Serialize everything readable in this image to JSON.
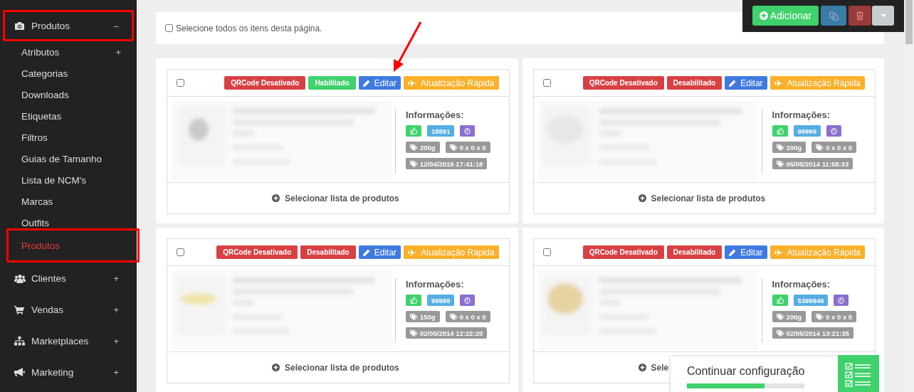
{
  "sidebar": {
    "groups": [
      {
        "label": "Produtos",
        "toggle": "–",
        "highlighted": true,
        "items": [
          {
            "label": "Atributos",
            "toggle": "+",
            "selected": false,
            "highlighted": false
          },
          {
            "label": "Categorias",
            "selected": false,
            "highlighted": false
          },
          {
            "label": "Downloads",
            "selected": false,
            "highlighted": false
          },
          {
            "label": "Etiquetas",
            "selected": false,
            "highlighted": false
          },
          {
            "label": "Filtros",
            "selected": false,
            "highlighted": false
          },
          {
            "label": "Guias de Tamanho",
            "selected": false,
            "highlighted": false
          },
          {
            "label": "Lista de NCM's",
            "selected": false,
            "highlighted": false
          },
          {
            "label": "Marcas",
            "selected": false,
            "highlighted": false
          },
          {
            "label": "Outfits",
            "selected": false,
            "highlighted": false
          },
          {
            "label": "Produtos",
            "selected": true,
            "highlighted": true
          }
        ]
      },
      {
        "label": "Clientes",
        "toggle": "+",
        "highlighted": false
      },
      {
        "label": "Vendas",
        "toggle": "+",
        "highlighted": false
      },
      {
        "label": "Marketplaces",
        "toggle": "+",
        "highlighted": false
      },
      {
        "label": "Marketing",
        "toggle": "+",
        "highlighted": false
      }
    ]
  },
  "toolbar": {
    "add_label": "Adicionar"
  },
  "select_all": {
    "label": "Selecione todos os itens desta página.",
    "checked": false
  },
  "cards": [
    {
      "checked": false,
      "qrcode": {
        "label": "QRCode Desativado",
        "enabled": false
      },
      "status": {
        "label": "Habilitado",
        "enabled": true
      },
      "edit": "Editar",
      "quick_update": "Atualização Rápida",
      "info_title": "Informações:",
      "code": "18991",
      "weight": "200g",
      "dimensions": "0 x 0 x 0",
      "date": "12/04/2019 17:41:18",
      "footer": "Selecionar lista de produtos"
    },
    {
      "checked": false,
      "qrcode": {
        "label": "QRCode Desativado",
        "enabled": false
      },
      "status": {
        "label": "Desabilitado",
        "enabled": false
      },
      "edit": "Editar",
      "quick_update": "Atualização Rápida",
      "info_title": "Informações:",
      "code": "99999",
      "weight": "200g",
      "dimensions": "0 x 0 x 0",
      "date": "05/05/2014 11:58:33",
      "footer": "Selecionar lista de produtos"
    },
    {
      "checked": false,
      "qrcode": {
        "label": "QRCode Desativado",
        "enabled": false
      },
      "status": {
        "label": "Desabilitado",
        "enabled": false
      },
      "edit": "Editar",
      "quick_update": "Atualização Rápida",
      "info_title": "Informações:",
      "code": "99999",
      "weight": "150g",
      "dimensions": "0 x 0 x 0",
      "date": "02/05/2014 12:22:20",
      "footer": "Selecionar lista de produtos"
    },
    {
      "checked": false,
      "qrcode": {
        "label": "QRCode Desativado",
        "enabled": false
      },
      "status": {
        "label": "Desabilitado",
        "enabled": false
      },
      "edit": "Editar",
      "quick_update": "Atualização Rápida",
      "info_title": "Informações:",
      "code": "5399946",
      "weight": "200g",
      "dimensions": "0 x 0 x 0",
      "date": "02/05/2014 13:21:35",
      "footer": "Sele"
    }
  ],
  "setup": {
    "title": "Continuar configuração",
    "level": 0.66
  }
}
